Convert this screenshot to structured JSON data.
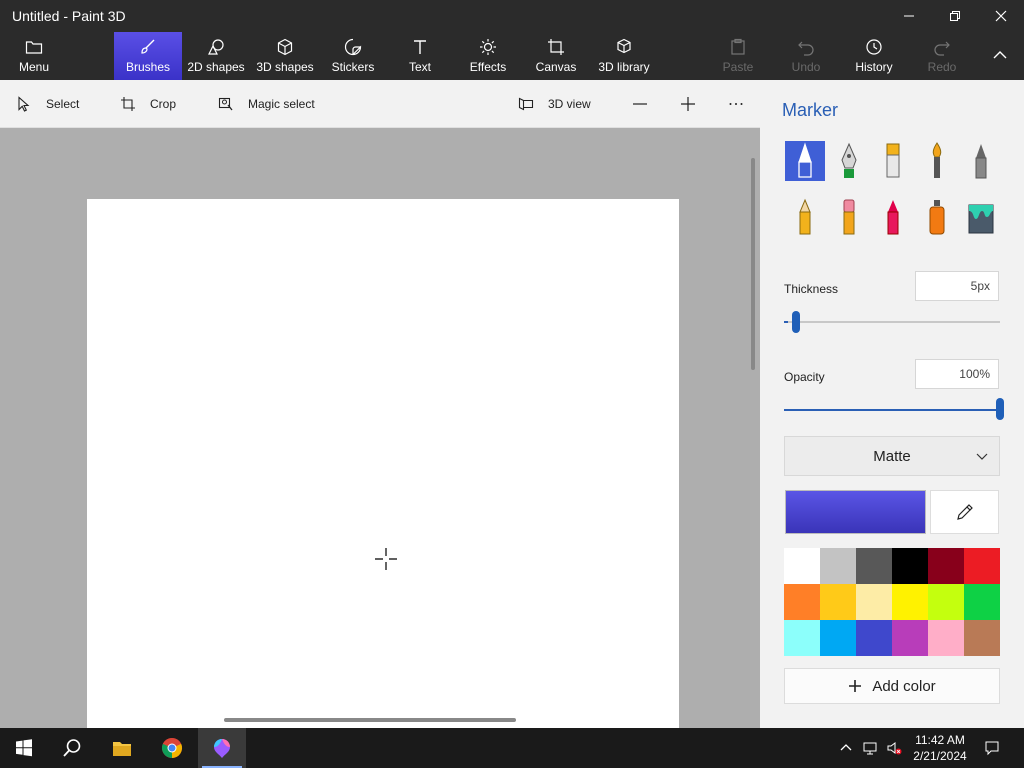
{
  "window": {
    "title": "Untitled - Paint 3D"
  },
  "ribbon": {
    "menu": "Menu",
    "brushes": "Brushes",
    "shapes2d": "2D shapes",
    "shapes3d": "3D shapes",
    "stickers": "Stickers",
    "text": "Text",
    "effects": "Effects",
    "canvas": "Canvas",
    "library3d": "3D library",
    "paste": "Paste",
    "undo": "Undo",
    "history": "History",
    "redo": "Redo"
  },
  "subtoolbar": {
    "select": "Select",
    "crop": "Crop",
    "magic_select": "Magic select",
    "view3d": "3D view"
  },
  "panel": {
    "title": "Marker",
    "brushes": [
      "marker-icon",
      "calligraphy-pen-icon",
      "oil-brush-icon",
      "watercolor-icon",
      "pixel-pen-icon",
      "pencil-icon",
      "eraser-icon",
      "crayon-icon",
      "spray-can-icon",
      "fill-bucket-icon"
    ],
    "thickness_label": "Thickness",
    "thickness_value": "5px",
    "thickness_fraction": 0.02,
    "opacity_label": "Opacity",
    "opacity_value": "100%",
    "opacity_fraction": 1.0,
    "finish": "Matte",
    "current_color": [
      "#5a55e6",
      "#3a34b8"
    ],
    "add_color": "Add color",
    "palette": [
      "#ffffff",
      "#c3c3c3",
      "#585858",
      "#000000",
      "#88001b",
      "#ec1c24",
      "#ff7f27",
      "#ffca18",
      "#fdeca6",
      "#fff200",
      "#c4ff0e",
      "#0ed145",
      "#8cfffb",
      "#00a8f3",
      "#3f48cc",
      "#b83dba",
      "#ffaec8",
      "#b97a56"
    ]
  },
  "taskbar": {
    "time": "11:42 AM",
    "date": "2/21/2024"
  }
}
